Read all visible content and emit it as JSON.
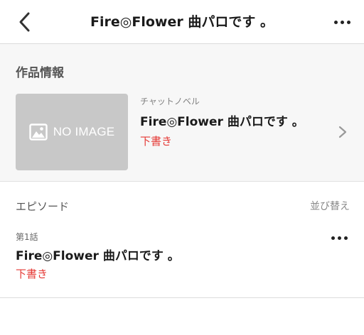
{
  "header": {
    "title": "Fire◎Flower 曲パロです 。",
    "back_icon": "chevron-left-icon",
    "more_icon": "more-horizontal-icon"
  },
  "work_info": {
    "heading": "作品情報",
    "thumbnail_text": "NO IMAGE",
    "type": "チャットノベル",
    "title": "Fire◎Flower 曲パロです 。",
    "status": "下書き",
    "status_color": "#e53935"
  },
  "episodes": {
    "heading": "エピソード",
    "sort_label": "並び替え",
    "items": [
      {
        "number": "第1話",
        "title": "Fire◎Flower 曲パロです 。",
        "status": "下書き"
      }
    ]
  }
}
